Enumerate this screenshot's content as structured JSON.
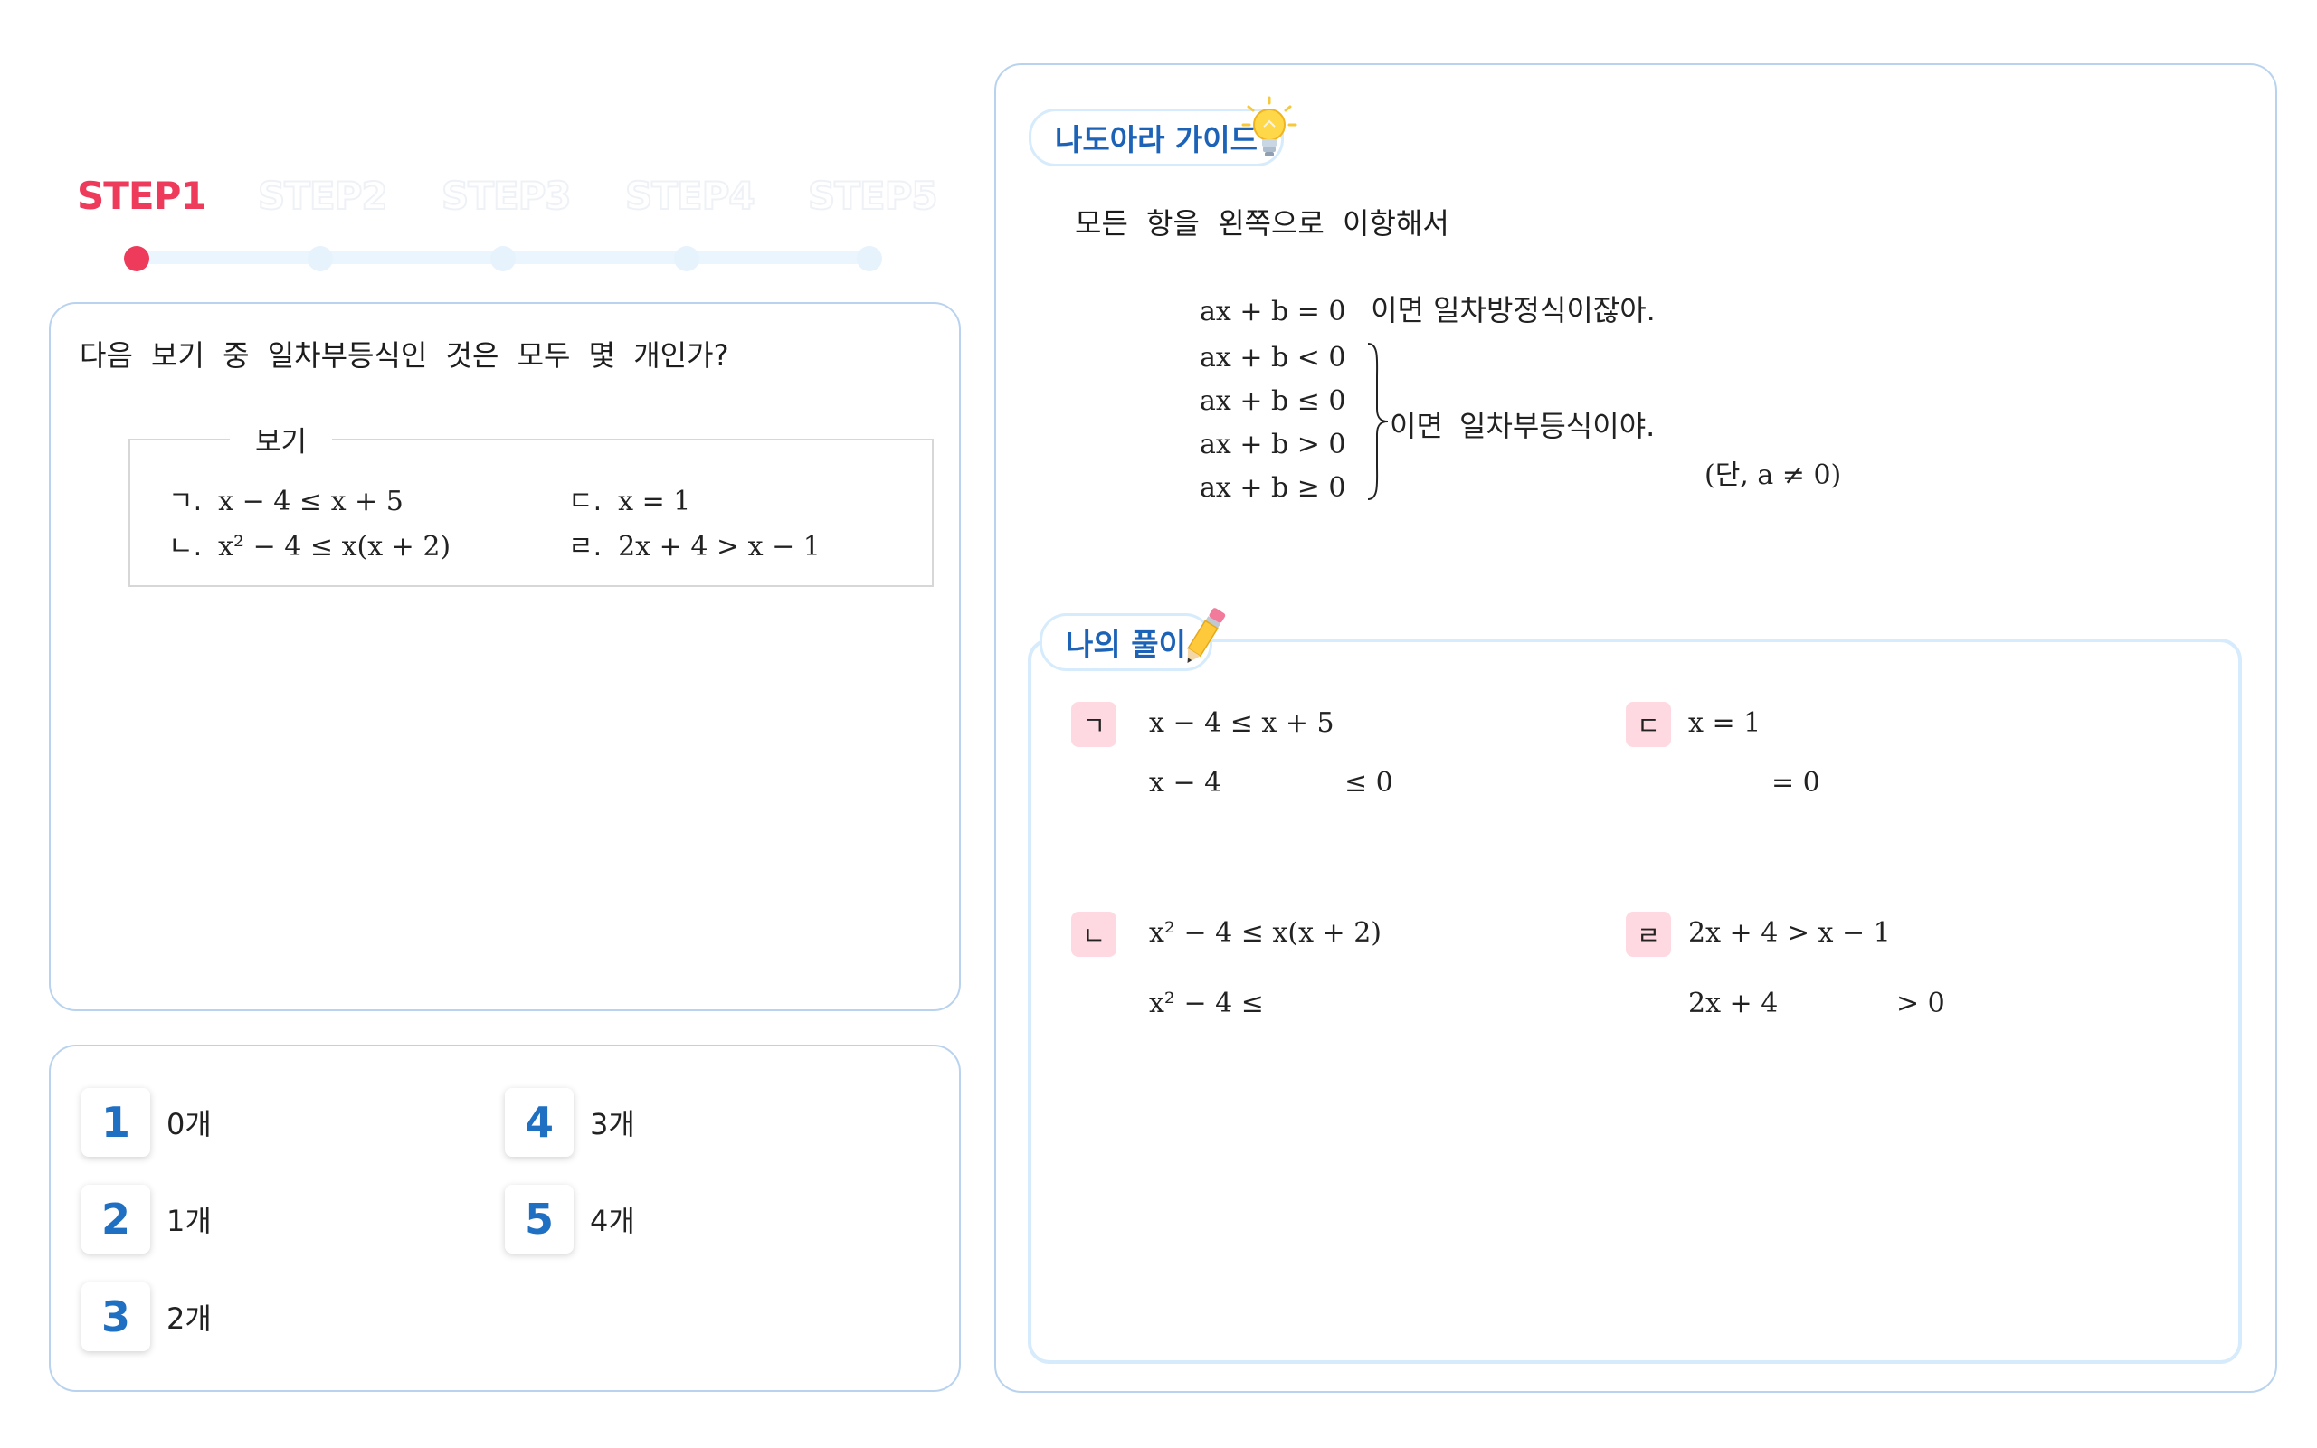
{
  "steps": [
    "STEP1",
    "STEP2",
    "STEP3",
    "STEP4",
    "STEP5"
  ],
  "active_step": 1,
  "question": {
    "text": "다음 보기 중 일차부등식인 것은 모두 몇 개인가?",
    "example_title": "보기",
    "items": [
      {
        "label": "ㄱ.",
        "expr": "x − 4 ≤ x + 5"
      },
      {
        "label": "ㄷ.",
        "expr": "x = 1"
      },
      {
        "label": "ㄴ.",
        "expr": "x² − 4 ≤ x(x + 2)"
      },
      {
        "label": "ㄹ.",
        "expr": "2x + 4 > x − 1"
      }
    ]
  },
  "options": [
    {
      "num": "1",
      "text": "0개"
    },
    {
      "num": "2",
      "text": "1개"
    },
    {
      "num": "3",
      "text": "2개"
    },
    {
      "num": "4",
      "text": "3개"
    },
    {
      "num": "5",
      "text": "4개"
    }
  ],
  "guide": {
    "title": "나도아라 가이드",
    "intro": "모든 항을 왼쪽으로 이항해서",
    "eq_equation": "ax + b = 0",
    "eq_equation_suffix": "이면 일차방정식이잖아.",
    "ineqs": [
      "ax + b < 0",
      "ax + b ≤ 0",
      "ax + b > 0",
      "ax + b ≥ 0"
    ],
    "ineq_suffix": "이면 일차부등식이야.",
    "condition": "(단, a ≠ 0)"
  },
  "solution": {
    "title": "나의 풀이",
    "items": [
      {
        "badge": "ㄱ",
        "line1": "x − 4 ≤ x + 5",
        "line2a": "x − 4",
        "line2b": "≤ 0"
      },
      {
        "badge": "ㄷ",
        "line1": "x = 1",
        "line2a": "",
        "line2b": "= 0"
      },
      {
        "badge": "ㄴ",
        "line1": "x² − 4 ≤ x(x + 2)",
        "line2a": "x² − 4 ≤",
        "line2b": ""
      },
      {
        "badge": "ㄹ",
        "line1": "2x + 4 > x − 1",
        "line2a": "2x + 4",
        "line2b": "> 0"
      }
    ]
  },
  "colors": {
    "accent_red": "#ee3b5b",
    "accent_blue": "#1f6fc2",
    "panel_border": "#b9d3ef",
    "badge_pink": "#ffd9e1"
  },
  "icons": [
    "lightbulb-icon",
    "pencil-icon"
  ]
}
